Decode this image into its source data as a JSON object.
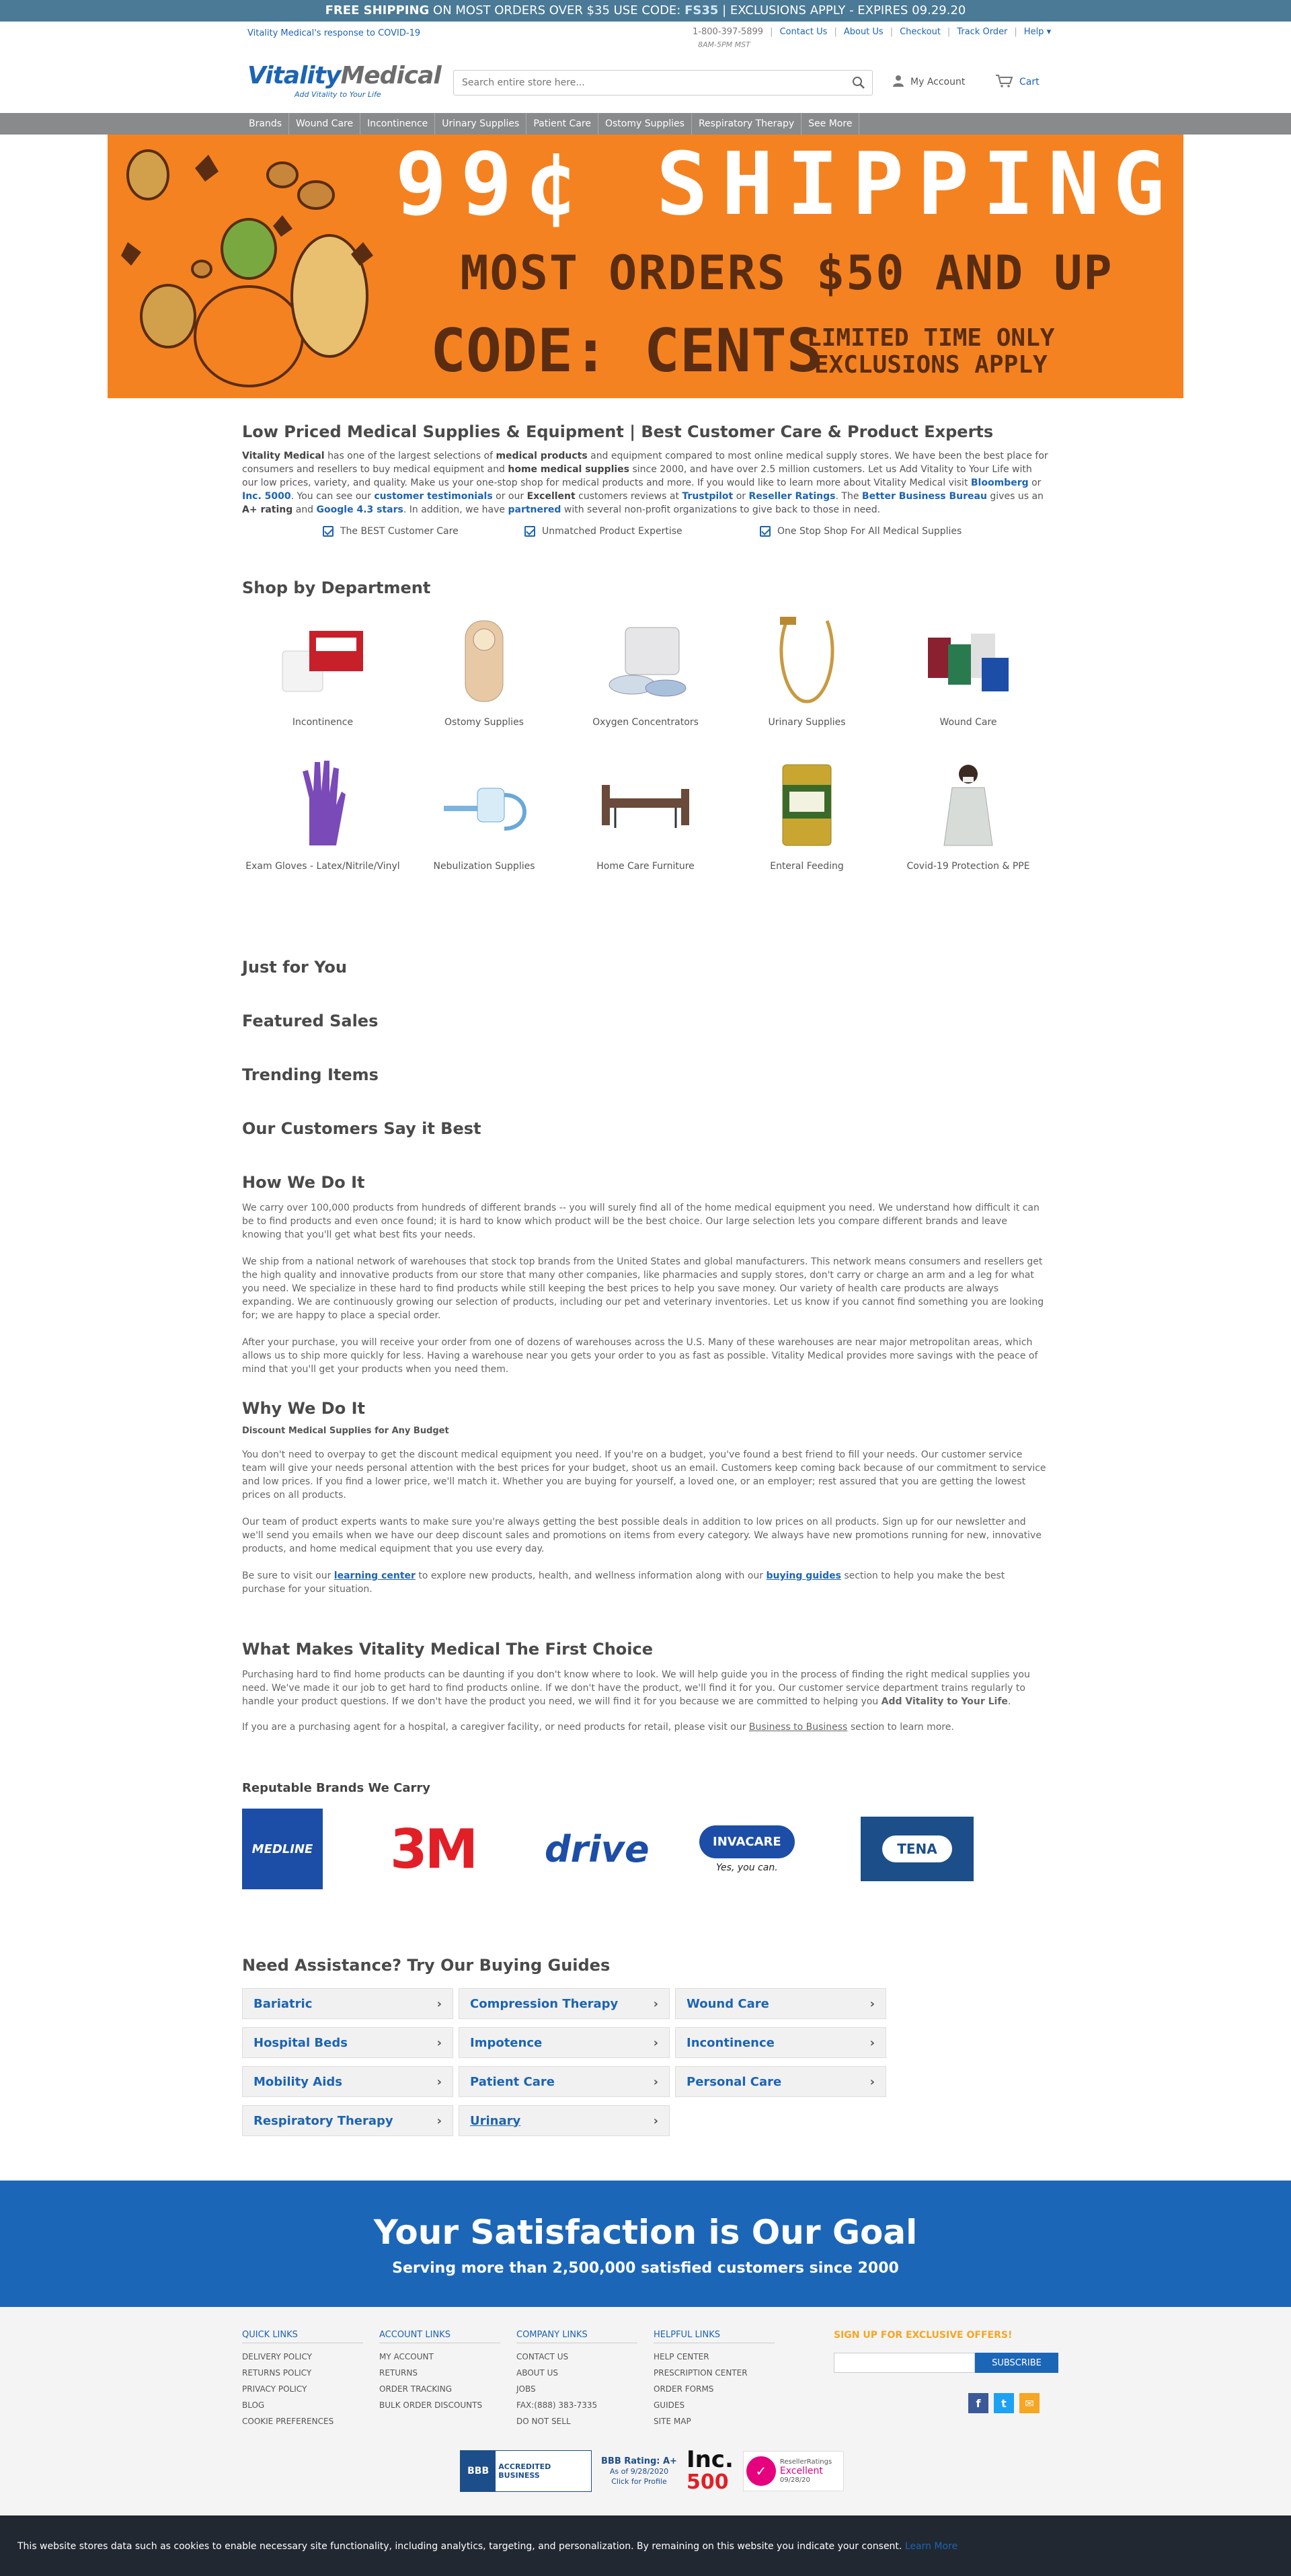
{
  "top_banner": {
    "lead": "FREE SHIPPING",
    "middle": " ON MOST ORDERS OVER $35 USE CODE: ",
    "code": "FS35",
    "tail": " | EXCLUSIONS APPLY - EXPIRES 09.29.20"
  },
  "utility": {
    "covid_link": "Vitality Medical's response to COVID-19",
    "phone": "1-800-397-5899",
    "links": [
      "Contact Us",
      "About Us",
      "Checkout",
      "Track Order",
      "Help"
    ],
    "hours": "8AM-5PM MST"
  },
  "header": {
    "logo_part1": "Vitality",
    "logo_part2": "Medical",
    "logo_tagline": "Add Vitality to Your Life",
    "search_placeholder": "Search entire store here...",
    "account_label": "My Account",
    "cart_label": "Cart"
  },
  "nav": [
    "Brands",
    "Wound Care",
    "Incontinence",
    "Urinary Supplies",
    "Patient Care",
    "Ostomy Supplies",
    "Respiratory Therapy",
    "See More"
  ],
  "hero": {
    "line1": "99¢ SHIPPING",
    "line2": "MOST ORDERS $50 AND UP",
    "line3": "CODE: CENTS",
    "line4a": "LIMITED TIME ONLY",
    "line4b": "EXCLUSIONS APPLY"
  },
  "intro": {
    "title": "Low Priced Medical Supplies & Equipment | Best Customer Care & Product Experts",
    "p1": "has one of the largest selections of",
    "p1b": "medical products",
    "p1c": "and equipment compared to most online medical supply stores. We have been the best place for consumers and resellers to buy medical equipment and",
    "p1d": "home medical supplies",
    "p1e": "since 2000, and have over 2.5 million customers. Let us Add Vitality to Your Life with our low prices, variety, and quality. Make us your one-stop shop for medical products and more. If you would like to learn more about Vitality Medical visit",
    "brand": "Vitality Medical",
    "bloomberg": "Bloomberg",
    "or": "or",
    "inc5000": "Inc. 5000",
    "p2": ". You can see our",
    "testimonials": "customer testimonials",
    "p3": "or our",
    "excellent": "Excellent",
    "p4": "customers reviews at",
    "trustpilot": "Trustpilot",
    "or2": "or",
    "reseller": "Reseller Ratings",
    "p5": ". The",
    "bbb": "Better Business Bureau",
    "p6": "gives us an",
    "aplus": "A+ rating",
    "and": "and",
    "google": "Google 4.3 stars",
    "p7": ". In addition, we have",
    "partnered": "partnered",
    "p8": "with several non-profit organizations to give back to those in need.",
    "checks": [
      "The BEST Customer Care",
      "Unmatched Product Expertise",
      "One Stop Shop For All Medical Supplies"
    ]
  },
  "departments": {
    "title": "Shop by Department",
    "items": [
      {
        "label": "Incontinence",
        "icon": "incontinence-product"
      },
      {
        "label": "Ostomy Supplies",
        "icon": "ostomy-pouch"
      },
      {
        "label": "Oxygen Concentrators",
        "icon": "oxygen-concentrator"
      },
      {
        "label": "Urinary Supplies",
        "icon": "catheter"
      },
      {
        "label": "Wound Care",
        "icon": "bandage-rolls"
      },
      {
        "label": "Exam Gloves - Latex/Nitrile/Vinyl",
        "icon": "exam-glove"
      },
      {
        "label": "Nebulization Supplies",
        "icon": "nebulizer"
      },
      {
        "label": "Home Care Furniture",
        "icon": "hospital-bed"
      },
      {
        "label": "Enteral Feeding",
        "icon": "nutrition-can"
      },
      {
        "label": "Covid-19 Protection & PPE",
        "icon": "ppe-gown"
      }
    ]
  },
  "sections": {
    "just_for_you": "Just for You",
    "featured": "Featured Sales",
    "trending": "Trending Items",
    "customers": "Our Customers Say it Best"
  },
  "how": {
    "title": "How We Do It",
    "p1": "We carry over 100,000 products from hundreds of different brands -- you will surely find all of the home medical equipment you need. We understand how difficult it can be to find products and even once found; it is hard to know which product will be the best choice. Our large selection lets you compare different brands and leave knowing that you'll get what best fits your needs.",
    "p2": "We ship from a national network of warehouses that stock top brands from the United States and global manufacturers. This network means consumers and resellers get the high quality and innovative products from our store that many other companies, like pharmacies and supply stores, don't carry or charge an arm and a leg for what you need. We specialize in these hard to find products while still keeping the best prices to help you save money. Our variety of health care products are always expanding. We are continuously growing our selection of products, including our pet and veterinary inventories. Let us know if you cannot find something you are looking for; we are happy to place a special order.",
    "p3": "After your purchase, you will receive your order from one of dozens of warehouses across the U.S. Many of these warehouses are near major metropolitan areas, which allows us to ship more quickly for less. Having a warehouse near you gets your order to you as fast as possible. Vitality Medical provides more savings with the peace of mind that you'll get your products when you need them."
  },
  "why": {
    "title": "Why We Do It",
    "sub": "Discount Medical Supplies for Any Budget",
    "p1": "You don't need to overpay to get the discount medical equipment you need. If you're on a budget, you've found a best friend to fill your needs. Our customer service team will give your needs personal attention with the best prices for your budget, shoot us an email. Customers keep coming back because of our commitment to service and low prices. If you find a lower price, we'll match it. Whether you are buying for yourself, a loved one, or an employer; rest assured that you are getting the lowest prices on all products.",
    "p2": "Our team of product experts wants to make sure you're always getting the best possible deals in addition to low prices on all products. Sign up for our newsletter and we'll send you emails when we have our deep discount sales and promotions on items from every category. We always have new promotions running for new, innovative products, and home medical equipment that you use every day.",
    "p3a": "Be sure to visit our",
    "learning": "learning center",
    "p3b": "to explore new products, health, and wellness information along with our",
    "buying": "buying guides",
    "p3c": "section to help you make the best purchase for your situation."
  },
  "choice": {
    "title": "What Makes Vitality Medical The First Choice",
    "p1": "Purchasing hard to find home products can be daunting if you don't know where to look. We will help guide you in the process of finding the right medical supplies you need. We've made it our job to get hard to find products online. If we don't have the product, we'll find it for you. Our customer service department trains regularly to handle your product questions. If we don't have the product you need, we will find it for you because we are committed to helping you",
    "p1b": "Add Vitality to Your Life",
    "p2a": "If you are a purchasing agent for a hospital, a caregiver facility, or need products for retail, please visit our",
    "b2b": "Business to Business",
    "p2b": "section to learn more."
  },
  "brands": {
    "title": "Reputable Brands We Carry",
    "medline": "MEDLINE",
    "threem": "3M",
    "drive": "drive",
    "invacare": "INVACARE",
    "invacare_tag": "Yes, you can.",
    "tena": "TENA"
  },
  "guides": {
    "title": "Need Assistance? Try Our Buying Guides",
    "items": [
      "Bariatric",
      "Compression Therapy",
      "Wound Care",
      "Hospital Beds",
      "Impotence",
      "Incontinence",
      "Mobility Aids",
      "Patient Care",
      "Personal Care",
      "Respiratory Therapy",
      "Urinary"
    ]
  },
  "satisfaction": {
    "title": "Your Satisfaction is Our Goal",
    "subtitle": "Serving more than 2,500,000 satisfied customers since 2000"
  },
  "footer": {
    "quick": {
      "title": "QUICK LINKS",
      "items": [
        "DELIVERY POLICY",
        "RETURNS POLICY",
        "PRIVACY POLICY",
        "BLOG",
        "COOKIE PREFERENCES"
      ]
    },
    "account": {
      "title": "ACCOUNT LINKS",
      "items": [
        "MY ACCOUNT",
        "RETURNS",
        "ORDER TRACKING",
        "BULK ORDER DISCOUNTS"
      ]
    },
    "company": {
      "title": "COMPANY LINKS",
      "items": [
        "CONTACT US",
        "ABOUT US",
        "JOBS",
        "FAX:(888) 383-7335",
        "DO NOT SELL"
      ]
    },
    "helpful": {
      "title": "HELPFUL LINKS",
      "items": [
        "HELP CENTER",
        "PRESCRIPTION CENTER",
        "ORDER FORMS",
        "GUIDES",
        "SITE MAP"
      ]
    },
    "signup_title": "SIGN UP FOR EXCLUSIVE OFFERS!",
    "subscribe": "SUBSCRIBE",
    "bbb_badge": "ACCREDITED BUSINESS",
    "bbb_rating": "BBB Rating: A+",
    "bbb_asof": "As of 9/28/2020",
    "bbb_click": "Click for Profile",
    "inc_top": "Inc.",
    "inc_num": "500",
    "rr_name": "ResellerRatings",
    "rr_rating": "Excellent",
    "rr_date": "09/28/20"
  },
  "cookie": {
    "text": "This website stores data such as cookies to enable necessary site functionality, including analytics, targeting, and personalization. By remaining on this website you indicate your consent.",
    "link": "Learn More"
  },
  "colors": {
    "brand_blue": "#1c64b4",
    "banner_blue": "#4a7a96",
    "hero_orange": "#f58220",
    "satisfaction_blue": "#1c66b8"
  }
}
